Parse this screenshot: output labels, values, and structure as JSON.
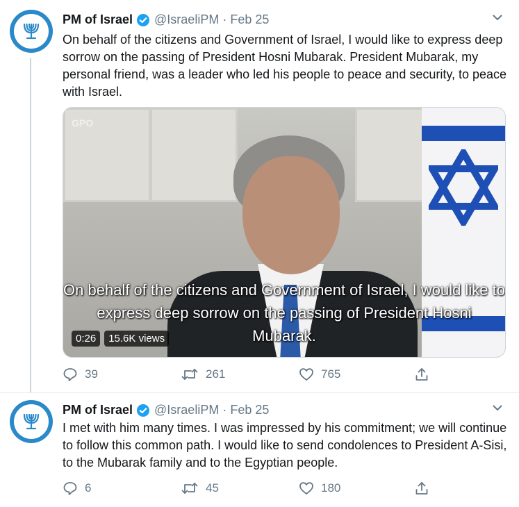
{
  "colors": {
    "accent": "#1da1f2",
    "muted": "#657786",
    "text": "#14171a"
  },
  "tweets": [
    {
      "name": "PM of Israel",
      "handle": "@IsraeliPM",
      "separator": "·",
      "date": "Feb 25",
      "text": "On behalf of the citizens and Government of Israel, I would like to express deep sorrow on the passing of President Hosni Mubarak. President Mubarak, my personal friend, was a leader who led his people to peace and security, to peace with Israel.",
      "video": {
        "watermark": "GPO",
        "subtitle": "On behalf of the citizens and Government of Israel, I would like to express deep sorrow on the passing of President Hosni Mubarak.",
        "duration": "0:26",
        "views": "15.6K views"
      },
      "replies": "39",
      "retweets": "261",
      "likes": "765"
    },
    {
      "name": "PM of Israel",
      "handle": "@IsraeliPM",
      "separator": "·",
      "date": "Feb 25",
      "text": "I met with him many times. I was impressed by his commitment; we will continue to follow this common path. I would like to send condolences to President A-Sisi, to the Mubarak family and to the Egyptian people.",
      "replies": "6",
      "retweets": "45",
      "likes": "180"
    }
  ]
}
